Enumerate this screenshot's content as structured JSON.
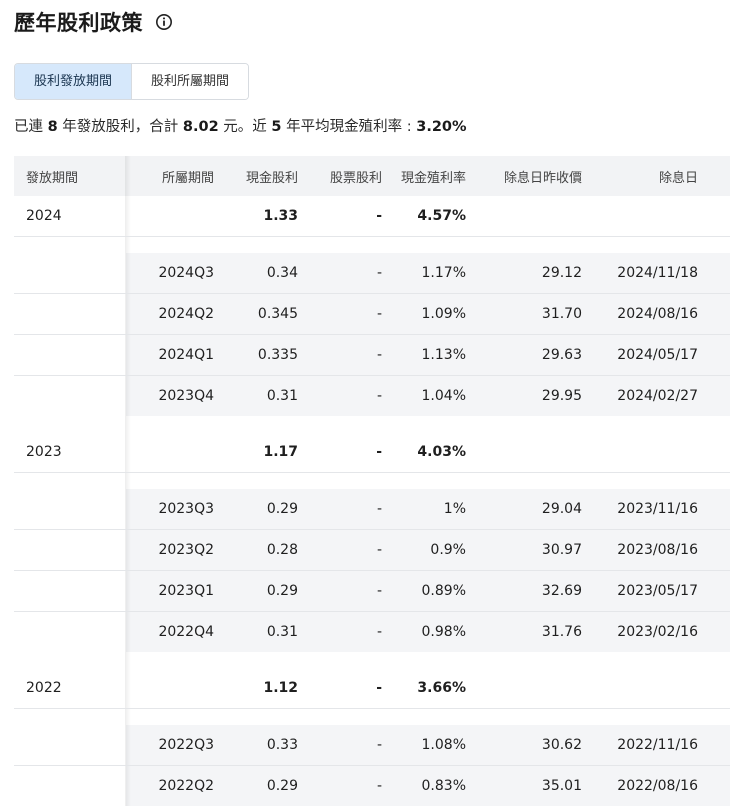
{
  "page": {
    "title": "歷年股利政策"
  },
  "tabs": [
    {
      "label": "股利發放期間",
      "active": true
    },
    {
      "label": "股利所屬期間",
      "active": false
    }
  ],
  "summary": {
    "p1": "已連 ",
    "years": "8",
    "p2": " 年發放股利，合計 ",
    "total": "8.02",
    "p3": " 元。近 ",
    "recent": "5",
    "p4": " 年平均現金殖利率 : ",
    "avg": "3.20%"
  },
  "table": {
    "headers": [
      "發放期間",
      "所屬期間",
      "現金股利",
      "股票股利",
      "現金殖利率",
      "除息日昨收價",
      "除息日"
    ],
    "groups": [
      {
        "year": "2024",
        "cash": "1.33",
        "stock": "-",
        "yield": "4.57%",
        "quarters": [
          {
            "period": "2024Q3",
            "cash": "0.34",
            "stock": "-",
            "yield": "1.17%",
            "price": "29.12",
            "date": "2024/11/18"
          },
          {
            "period": "2024Q2",
            "cash": "0.345",
            "stock": "-",
            "yield": "1.09%",
            "price": "31.70",
            "date": "2024/08/16"
          },
          {
            "period": "2024Q1",
            "cash": "0.335",
            "stock": "-",
            "yield": "1.13%",
            "price": "29.63",
            "date": "2024/05/17"
          },
          {
            "period": "2023Q4",
            "cash": "0.31",
            "stock": "-",
            "yield": "1.04%",
            "price": "29.95",
            "date": "2024/02/27"
          }
        ]
      },
      {
        "year": "2023",
        "cash": "1.17",
        "stock": "-",
        "yield": "4.03%",
        "quarters": [
          {
            "period": "2023Q3",
            "cash": "0.29",
            "stock": "-",
            "yield": "1%",
            "price": "29.04",
            "date": "2023/11/16"
          },
          {
            "period": "2023Q2",
            "cash": "0.28",
            "stock": "-",
            "yield": "0.9%",
            "price": "30.97",
            "date": "2023/08/16"
          },
          {
            "period": "2023Q1",
            "cash": "0.29",
            "stock": "-",
            "yield": "0.89%",
            "price": "32.69",
            "date": "2023/05/17"
          },
          {
            "period": "2022Q4",
            "cash": "0.31",
            "stock": "-",
            "yield": "0.98%",
            "price": "31.76",
            "date": "2023/02/16"
          }
        ]
      },
      {
        "year": "2022",
        "cash": "1.12",
        "stock": "-",
        "yield": "3.66%",
        "quarters": [
          {
            "period": "2022Q3",
            "cash": "0.33",
            "stock": "-",
            "yield": "1.08%",
            "price": "30.62",
            "date": "2022/11/16"
          },
          {
            "period": "2022Q2",
            "cash": "0.29",
            "stock": "-",
            "yield": "0.83%",
            "price": "35.01",
            "date": "2022/08/16"
          }
        ]
      }
    ]
  }
}
